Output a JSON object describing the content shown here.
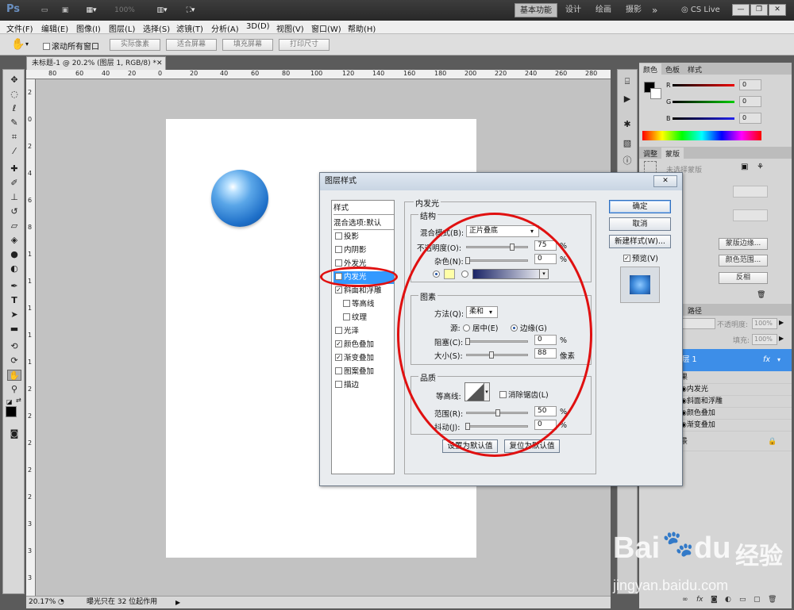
{
  "app": {
    "logo": "Ps",
    "zoom_display": "100%",
    "workspaces": [
      "基本功能",
      "设计",
      "绘画",
      "摄影"
    ],
    "more": "»",
    "cs_live": "CS Live"
  },
  "menu": [
    "文件(F)",
    "编辑(E)",
    "图像(I)",
    "图层(L)",
    "选择(S)",
    "滤镜(T)",
    "分析(A)",
    "3D(D)",
    "视图(V)",
    "窗口(W)",
    "帮助(H)"
  ],
  "options": {
    "scroll_all_label": "滚动所有窗口",
    "buttons": [
      "实际像素",
      "适合屏幕",
      "填充屏幕",
      "打印尺寸"
    ]
  },
  "document": {
    "tab_label": "未标题-1 @ 20.2% (图层 1, RGB/8) *",
    "ruler_h": [
      "80",
      "60",
      "40",
      "20",
      "0",
      "20",
      "40",
      "60",
      "80",
      "100",
      "120",
      "140",
      "160",
      "180",
      "200",
      "220",
      "240",
      "260",
      "280"
    ],
    "ruler_v": [
      "2",
      "0",
      "2",
      "4",
      "6",
      "8",
      "1",
      "1",
      "1",
      "1",
      "1",
      "2",
      "2",
      "2",
      "2",
      "2",
      "3",
      "3",
      "3"
    ]
  },
  "status": {
    "zoom": "20.17%",
    "message": "曝光只在 32 位起作用"
  },
  "panels": {
    "color_tabs": [
      "颜色",
      "色板",
      "样式"
    ],
    "channels": [
      "R",
      "G",
      "B"
    ],
    "channel_values": [
      "0",
      "0",
      "0"
    ],
    "adjust_tabs": [
      "调整",
      "蒙版"
    ],
    "mask_label": "未选择蒙版",
    "mask_buttons": [
      "蒙版边缘...",
      "颜色范围...",
      "反相"
    ],
    "layers_tab": "路径",
    "opacity_label": "不透明度:",
    "opacity_value": "100%",
    "fill_label": "填充:",
    "fill_value": "100%",
    "layer_name": "层 1",
    "layer_fx": "fx",
    "effects_title": "果",
    "effects": [
      "内发光",
      "斜面和浮雕",
      "颜色叠加",
      "渐变叠加"
    ],
    "background": "景"
  },
  "dialog": {
    "title": "图层样式",
    "close": "✕",
    "styles_header": "样式",
    "blend_options": "混合选项:默认",
    "styles": [
      {
        "label": "投影",
        "checked": false,
        "indent": false
      },
      {
        "label": "内阴影",
        "checked": false,
        "indent": false
      },
      {
        "label": "外发光",
        "checked": false,
        "indent": false
      },
      {
        "label": "内发光",
        "checked": true,
        "indent": false,
        "selected": true
      },
      {
        "label": "斜面和浮雕",
        "checked": true,
        "indent": false
      },
      {
        "label": "等高线",
        "checked": false,
        "indent": true
      },
      {
        "label": "纹理",
        "checked": false,
        "indent": true
      },
      {
        "label": "光泽",
        "checked": false,
        "indent": false
      },
      {
        "label": "颜色叠加",
        "checked": true,
        "indent": false
      },
      {
        "label": "渐变叠加",
        "checked": true,
        "indent": false
      },
      {
        "label": "图案叠加",
        "checked": false,
        "indent": false
      },
      {
        "label": "描边",
        "checked": false,
        "indent": false
      }
    ],
    "section_title": "内发光",
    "structure": {
      "legend": "结构",
      "blend_mode_label": "混合模式(B):",
      "blend_mode_value": "正片叠底",
      "opacity_label": "不透明度(O):",
      "opacity_value": "75",
      "noise_label": "杂色(N):",
      "noise_value": "0",
      "pct": "%"
    },
    "elements": {
      "legend": "图素",
      "method_label": "方法(Q):",
      "method_value": "柔和",
      "source_label": "源:",
      "center_label": "居中(E)",
      "edge_label": "边缘(G)",
      "choke_label": "阻塞(C):",
      "choke_value": "0",
      "size_label": "大小(S):",
      "size_value": "88",
      "px": "像素"
    },
    "quality": {
      "legend": "品质",
      "contour_label": "等高线:",
      "antialias_label": "消除锯齿(L)",
      "range_label": "范围(R):",
      "range_value": "50",
      "jitter_label": "抖动(J):",
      "jitter_value": "0"
    },
    "bottom_buttons": [
      "设置为默认值",
      "复位为默认值"
    ],
    "ok": "确定",
    "cancel": "取消",
    "new_style": "新建样式(W)...",
    "preview_label": "预览(V)"
  },
  "watermark": {
    "brand": "Bai",
    "brand2": "du",
    "cn": "经验",
    "url": "jingyan.baidu.com"
  },
  "colors": {
    "accent": "#3399ff",
    "annotation": "#e01010",
    "glow_swatch": "#ffffa8"
  }
}
